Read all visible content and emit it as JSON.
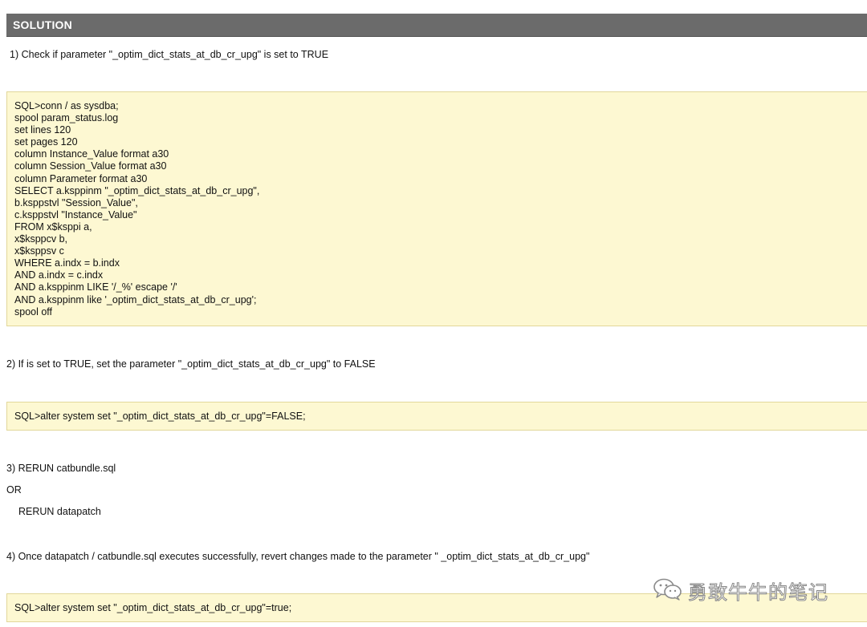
{
  "header": {
    "title": "SOLUTION"
  },
  "steps": {
    "step1": "1) Check if parameter \"_optim_dict_stats_at_db_cr_upg\" is set to TRUE",
    "step2": "2) If is set to TRUE, set the parameter \"_optim_dict_stats_at_db_cr_upg\" to FALSE",
    "step3": "3) RERUN catbundle.sql",
    "or": "OR",
    "step3b": "RERUN datapatch",
    "step4": "4) Once datapatch / catbundle.sql executes successfully, revert changes made to the parameter \" _optim_dict_stats_at_db_cr_upg\""
  },
  "code_blocks": {
    "check_query": [
      "SQL>conn / as sysdba;",
      "spool param_status.log",
      "set lines 120",
      "set pages 120",
      "column Instance_Value format a30",
      "column Session_Value format a30",
      "column Parameter format a30",
      "SELECT a.ksppinm \"_optim_dict_stats_at_db_cr_upg\",",
      "b.ksppstvl \"Session_Value\",",
      "c.ksppstvl \"Instance_Value\"",
      "FROM x$ksppi a,",
      "x$ksppcv b,",
      "x$ksppsv c",
      "WHERE a.indx = b.indx",
      "AND a.indx = c.indx",
      "AND a.ksppinm LIKE '/_%' escape '/'",
      "AND a.ksppinm like '_optim_dict_stats_at_db_cr_upg';",
      "spool off"
    ],
    "set_false": "SQL>alter system set \"_optim_dict_stats_at_db_cr_upg\"=FALSE;",
    "set_true": "SQL>alter system set \"_optim_dict_stats_at_db_cr_upg\"=true;"
  },
  "watermark": {
    "text": "勇敢牛牛的笔记",
    "icon": "wechat-icon"
  },
  "colors": {
    "header_bg": "#6b6b6b",
    "code_bg": "#fdf8d2",
    "code_border": "#e2d79a"
  }
}
